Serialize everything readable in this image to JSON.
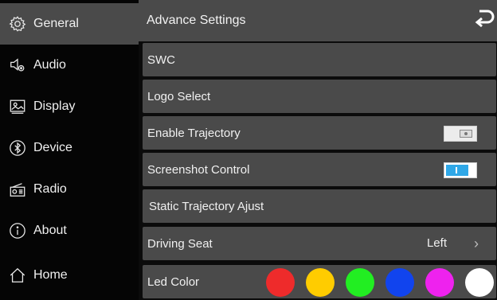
{
  "sidebar": {
    "items": [
      {
        "label": "General",
        "icon": "gear-icon"
      },
      {
        "label": "Audio",
        "icon": "speaker-icon"
      },
      {
        "label": "Display",
        "icon": "display-icon"
      },
      {
        "label": "Device",
        "icon": "bluetooth-icon"
      },
      {
        "label": "Radio",
        "icon": "radio-icon"
      },
      {
        "label": "About",
        "icon": "info-icon"
      },
      {
        "label": "Home",
        "icon": "home-icon"
      }
    ],
    "active_index": 0
  },
  "header": {
    "title": "Advance Settings",
    "back_icon": "back-arrow-icon"
  },
  "rows": {
    "swc": {
      "label": "SWC"
    },
    "logo": {
      "label": "Logo Select"
    },
    "trajectory": {
      "label": "Enable Trajectory",
      "enabled": false
    },
    "screenshot": {
      "label": "Screenshot Control",
      "enabled": true
    },
    "static": {
      "label": "Static Trajectory Ajust"
    },
    "seat": {
      "label": "Driving Seat",
      "value": "Left",
      "chevron": "chevron-right-icon"
    },
    "led": {
      "label": "Led Color",
      "colors": [
        "#ee2b2b",
        "#ffcc00",
        "#22ee22",
        "#1144ee",
        "#ee22ee",
        "#ffffff"
      ]
    }
  },
  "colors": {
    "accent": "#2fa8e8",
    "panel": "#4a4a4a",
    "background": "#0b0b0b"
  }
}
